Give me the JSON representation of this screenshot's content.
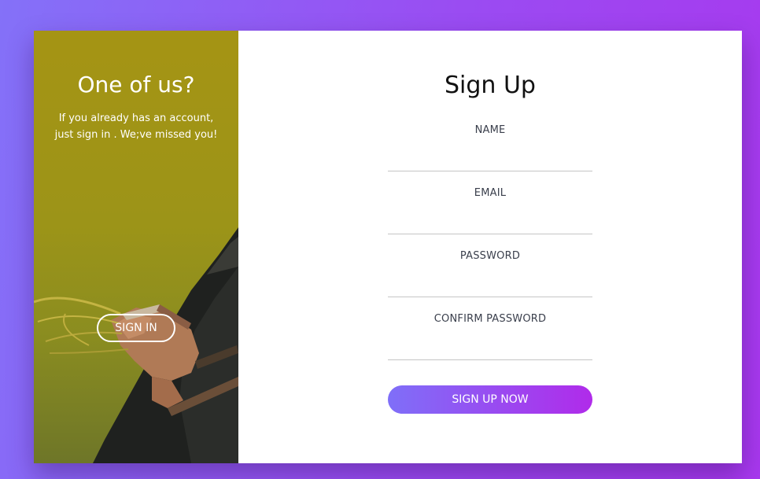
{
  "left_panel": {
    "title": "One of us?",
    "subtitle": "If you already has an account, just sign in . We;ve missed you!",
    "signin_label": "SIGN IN"
  },
  "form": {
    "title": "Sign Up",
    "fields": [
      {
        "label": "NAME",
        "value": ""
      },
      {
        "label": "EMAIL",
        "value": ""
      },
      {
        "label": "PASSWORD",
        "value": ""
      },
      {
        "label": "CONFIRM PASSWORD",
        "value": ""
      }
    ],
    "submit_label": "SIGN UP NOW"
  },
  "colors": {
    "background_start": "#8471f8",
    "background_end": "#a838ee",
    "button_start": "#7f6ff8",
    "button_end": "#b02bea",
    "panel_olive": "#a59414"
  }
}
